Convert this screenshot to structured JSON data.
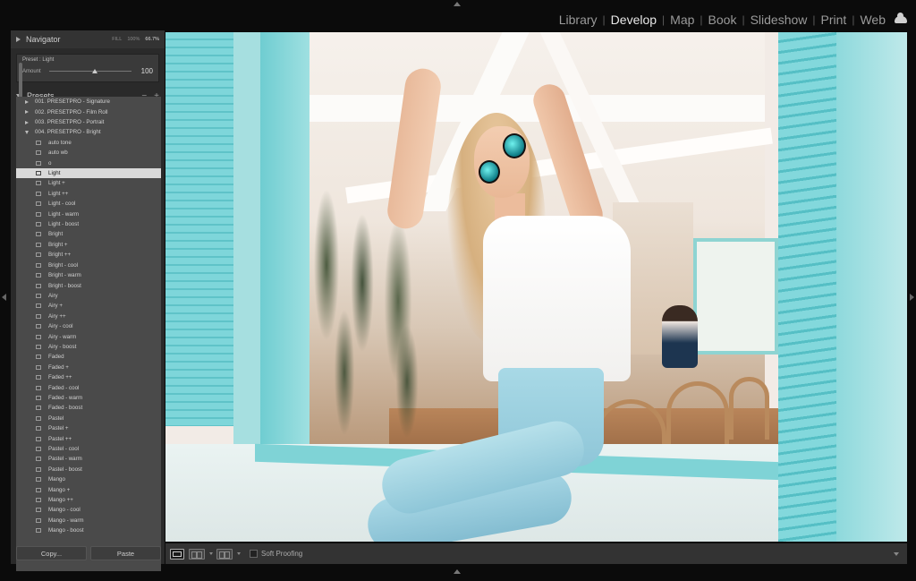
{
  "modules": {
    "items": [
      "Library",
      "Develop",
      "Map",
      "Book",
      "Slideshow",
      "Print",
      "Web"
    ],
    "active": "Develop",
    "separator": "|"
  },
  "navigator": {
    "title": "Navigator",
    "zoom_options": [
      "FILL",
      "100%",
      "66.7%"
    ],
    "zoom_selected": "66.7%"
  },
  "preset_amount": {
    "preset_name": "Preset : Light",
    "amount_label": "Amount",
    "amount_value": "100",
    "slider_fraction": 0.55
  },
  "presets_panel": {
    "title": "Presets",
    "minus": "−",
    "plus": "+",
    "folders": [
      "001. PRESETPRO - Signature",
      "002. PRESETPRO - Film Roll",
      "003. PRESETPRO - Portrait",
      "004. PRESETPRO - Bright"
    ],
    "open_folder_index": 3,
    "items": [
      "auto tone",
      "auto wb",
      "o",
      "Light",
      "Light +",
      "Light ++",
      "Light - cool",
      "Light - warm",
      "Light - boost",
      "Bright",
      "Bright +",
      "Bright ++",
      "Bright - cool",
      "Bright - warm",
      "Bright - boost",
      "Airy",
      "Airy +",
      "Airy ++",
      "Airy - cool",
      "Airy - warm",
      "Airy - boost",
      "Faded",
      "Faded +",
      "Faded ++",
      "Faded - cool",
      "Faded - warm",
      "Faded - boost",
      "Pastel",
      "Pastel +",
      "Pastel ++",
      "Pastel - cool",
      "Pastel - warm",
      "Pastel - boost",
      "Mango",
      "Mango +",
      "Mango ++",
      "Mango - cool",
      "Mango - warm",
      "Mango - boost"
    ],
    "selected_item": "Light"
  },
  "buttons": {
    "copy": "Copy...",
    "paste": "Paste"
  },
  "toolbar": {
    "soft_proofing": "Soft Proofing",
    "view_icons": [
      "loupe-view-icon",
      "before-after-view-icon",
      "yy-view-icon"
    ]
  },
  "colors": {
    "panel_bg": "#2a2a2a",
    "list_bg": "#4a4a4a",
    "selected_row": "#d9d9d9",
    "active_module": "#e8e8e8"
  }
}
